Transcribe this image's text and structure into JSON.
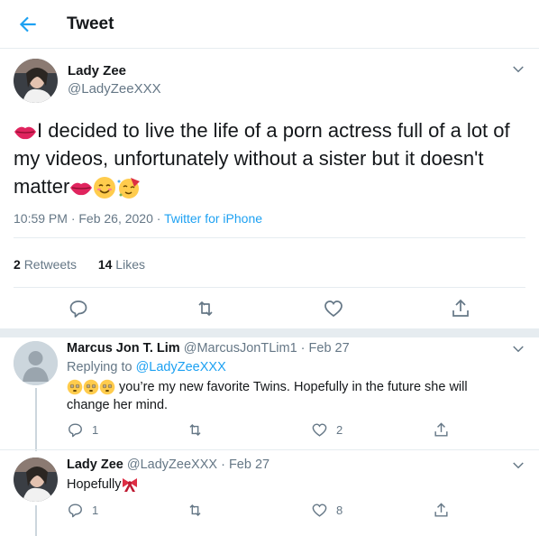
{
  "header": {
    "title": "Tweet"
  },
  "tweet": {
    "name": "Lady Zee",
    "handle": "@LadyZeeXXX",
    "text_part1": "I decided to live the life of a porn actress full of a lot of my videos, unfortunately without a sister but it doesn't matter",
    "time": "10:59 PM · Feb 26, 2020 · ",
    "source": "Twitter for iPhone",
    "retweets_count": "2",
    "retweets_label": "Retweets",
    "likes_count": "14",
    "likes_label": "Likes"
  },
  "replies": [
    {
      "name": "Marcus Jon T. Lim",
      "handle_date": "@MarcusJonTLim1 · Feb 27",
      "replying_prefix": "Replying to ",
      "replying_to": "@LadyZeeXXX",
      "text": " you’re my new favorite Twins. Hopefully in the future she will change her mind.",
      "reply_count": "1",
      "retweet_count": "",
      "like_count": "2"
    },
    {
      "name": "Lady Zee",
      "handle_date": "@LadyZeeXXX · Feb 27",
      "text": "Hopefully",
      "reply_count": "1",
      "retweet_count": "",
      "like_count": "8"
    }
  ],
  "colors": {
    "accent": "#1da1f2",
    "secondary_text": "#657786",
    "divider": "#e6ecf0"
  },
  "icons": [
    "back-arrow-icon",
    "chevron-down-icon",
    "reply-icon",
    "retweet-icon",
    "like-icon",
    "share-icon",
    "kiss-lips-icon",
    "smiling-face-icon",
    "partying-face-icon",
    "flushed-face-icon",
    "ribbon-icon"
  ]
}
